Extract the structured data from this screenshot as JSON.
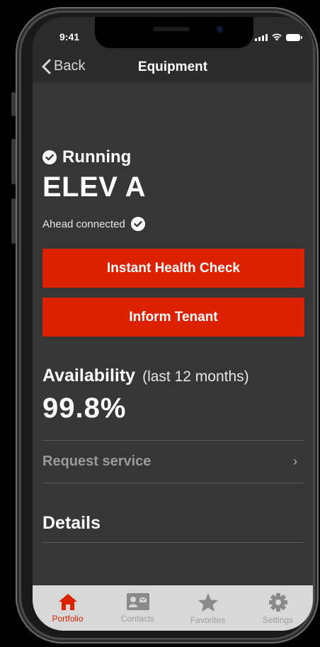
{
  "status_bar": {
    "time": "9:41"
  },
  "nav": {
    "back_label": "Back",
    "title": "Equipment"
  },
  "equipment": {
    "status": "Running",
    "name": "ELEV A",
    "connection": "Ahead connected"
  },
  "actions": {
    "health_check_label": "Instant Health Check",
    "inform_tenant_label": "Inform Tenant"
  },
  "availability": {
    "title": "Availability",
    "period": "(last 12 months)",
    "value": "99.8%"
  },
  "request_service": {
    "label": "Request service",
    "chevron": "›"
  },
  "details": {
    "title": "Details"
  },
  "tabbar": {
    "tabs": [
      {
        "label": "Portfolio",
        "icon": "home-icon",
        "active": true
      },
      {
        "label": "Contacts",
        "icon": "contact-card-icon",
        "active": false
      },
      {
        "label": "Favorites",
        "icon": "star-icon",
        "active": false
      },
      {
        "label": "Settings",
        "icon": "gear-icon",
        "active": false
      }
    ]
  },
  "colors": {
    "accent": "#dc2100",
    "background": "#363636",
    "header": "#2b2b2b",
    "tabbar": "#d8d8d8",
    "tab_inactive": "#9d9d9d"
  }
}
